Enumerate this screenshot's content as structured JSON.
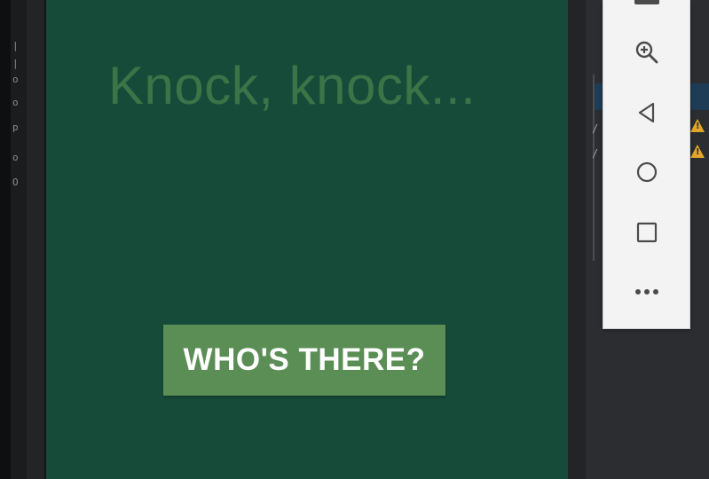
{
  "app": {
    "headline": "Knock, knock...",
    "answer_button_label": "WHO'S THERE?"
  },
  "colors": {
    "screen_background": "#164b3a",
    "headline_text": "#3b7447",
    "button_background": "#5a8e55",
    "button_text": "#ffffff",
    "warning": "#e2a628"
  },
  "ide": {
    "warnings": [
      "!",
      "!"
    ]
  },
  "emulator_toolbar": {
    "tools": [
      {
        "id": "screenshot",
        "icon": "camera-icon"
      },
      {
        "id": "zoom",
        "icon": "zoom-in-icon"
      },
      {
        "id": "back",
        "icon": "back-triangle-icon"
      },
      {
        "id": "home",
        "icon": "home-circle-icon"
      },
      {
        "id": "overview",
        "icon": "overview-square-icon"
      },
      {
        "id": "more",
        "icon": "more-dots-icon"
      }
    ]
  }
}
